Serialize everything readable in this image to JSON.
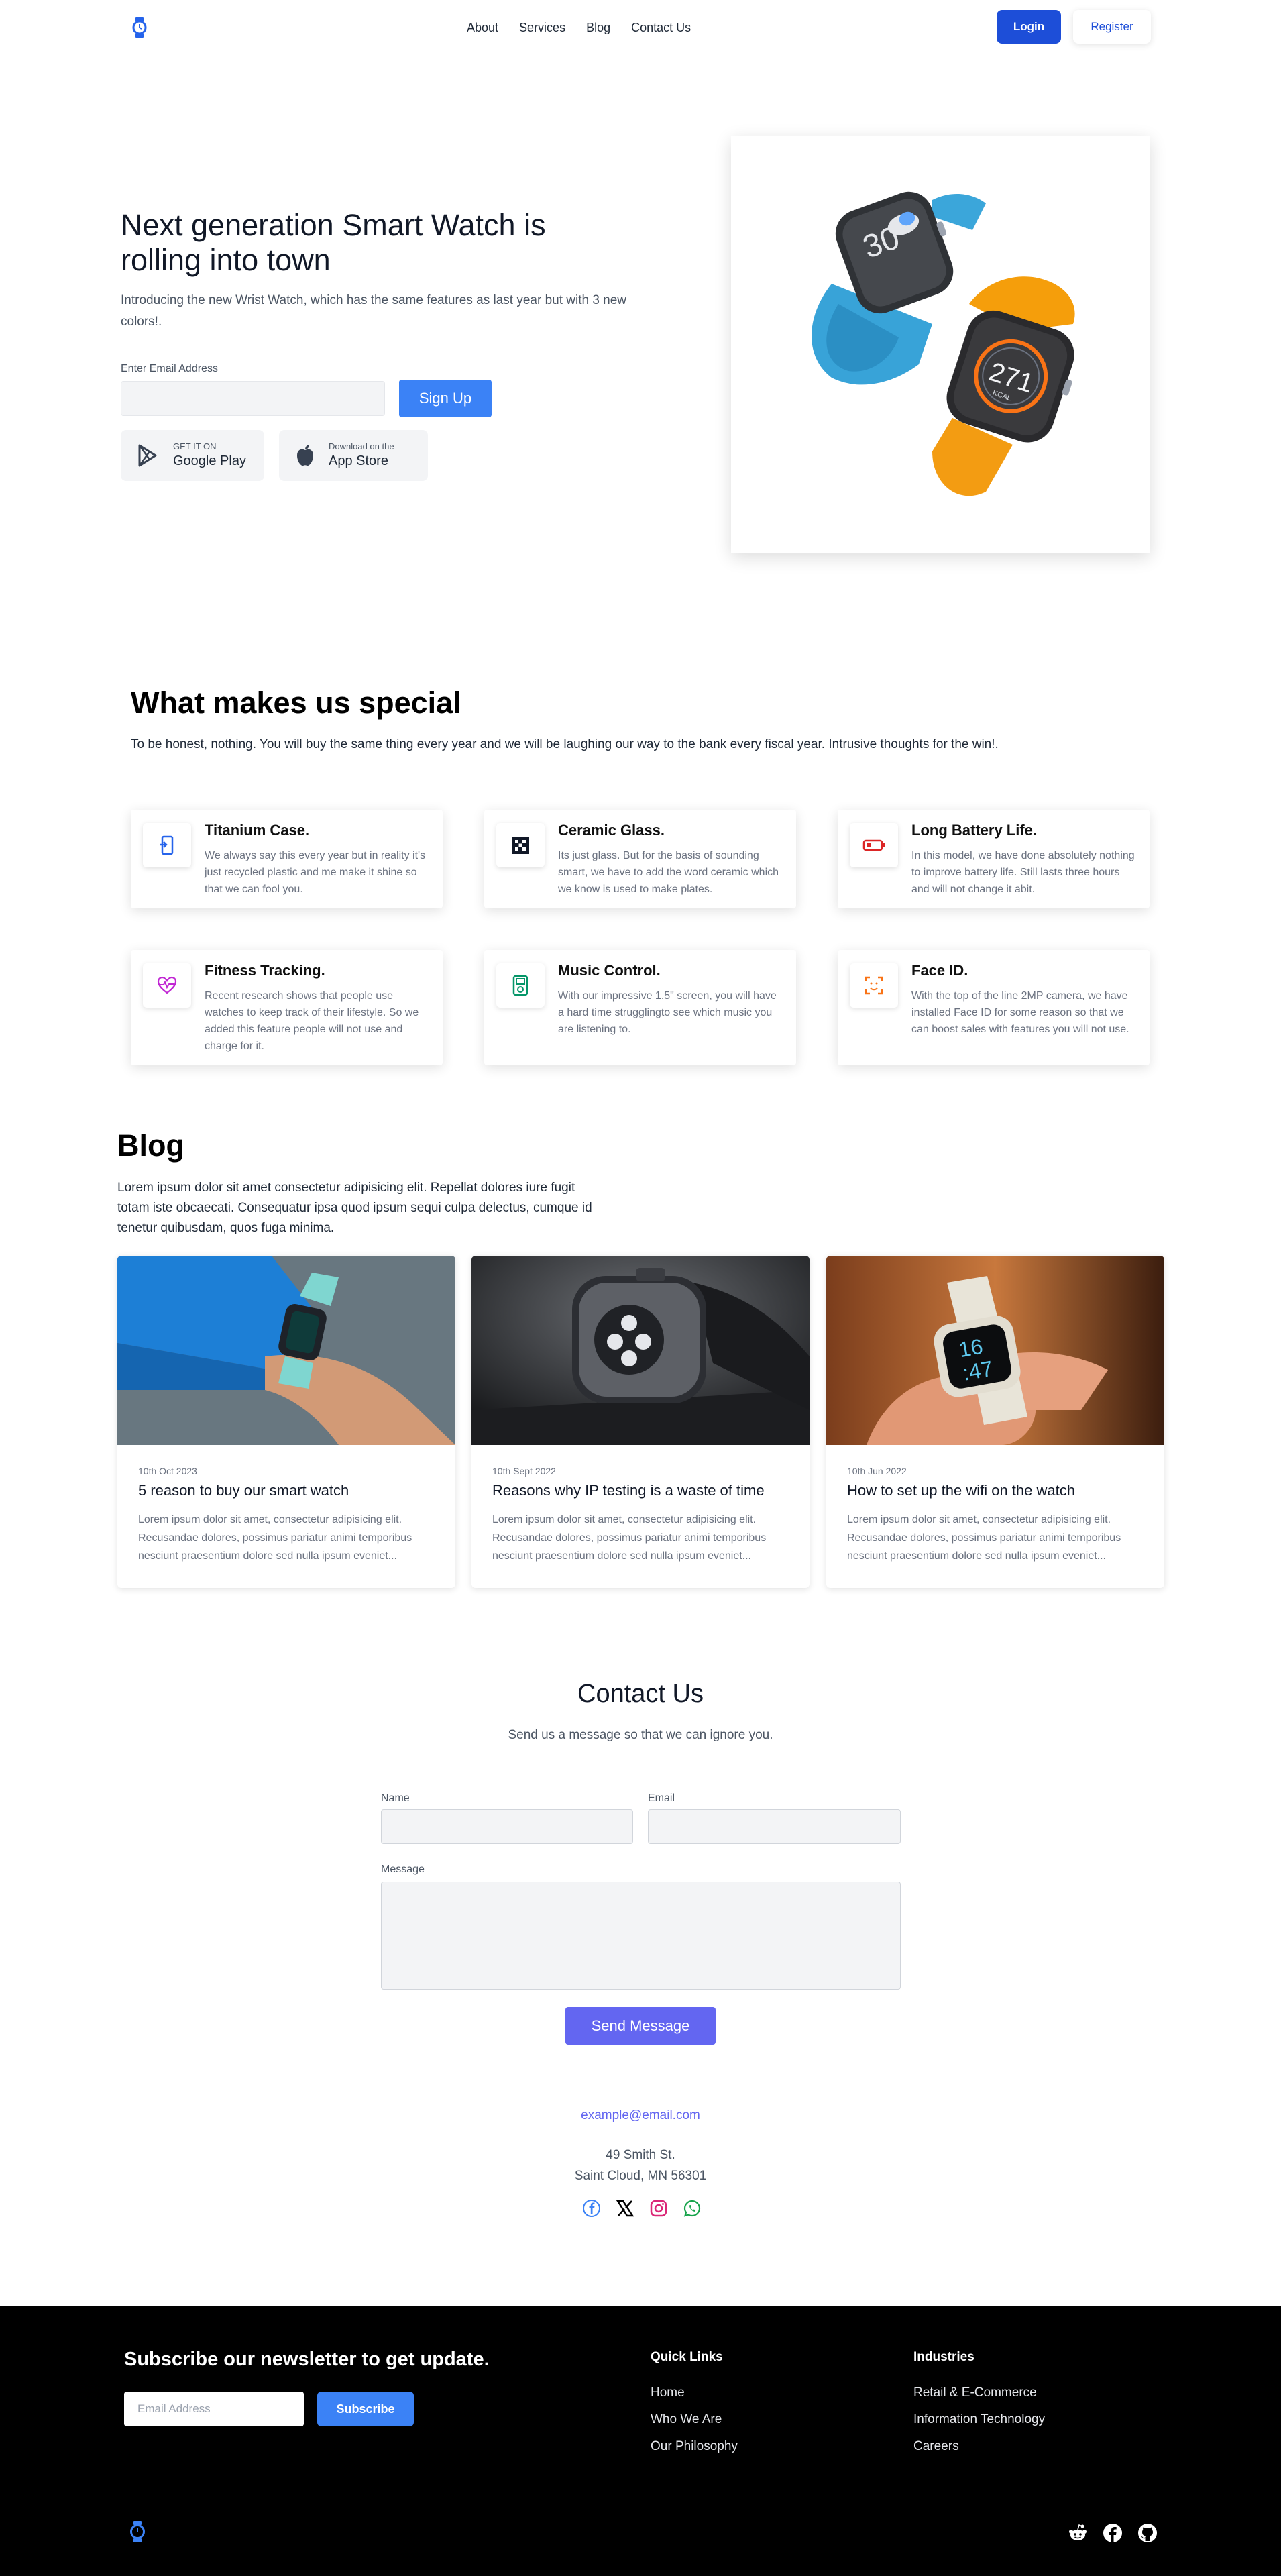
{
  "nav": {
    "logo_icon": "watch-icon",
    "links": [
      "About",
      "Services",
      "Blog",
      "Contact Us"
    ],
    "login_label": "Login",
    "register_label": "Register",
    "accent_color": "#1d4ed8"
  },
  "hero": {
    "title": "Next generation Smart Watch is rolling into town",
    "subtitle": "Introducing the new Wrist Watch, which has the same features as last year but with 3 new colors!.",
    "email_label": "Enter Email Address",
    "email_value": "",
    "signup_label": "Sign Up",
    "google_play": {
      "small": "GET IT ON",
      "big": "Google Play",
      "icon": "google-play-icon"
    },
    "app_store": {
      "small": "Download on the",
      "big": "App Store",
      "icon": "apple-icon"
    },
    "watch_blue": {
      "temp": "30"
    },
    "watch_orange": {
      "value": "271",
      "unit": "KCAL"
    }
  },
  "special": {
    "title": "What makes us special",
    "subtitle": "To be honest, nothing. You will buy the same thing every year and we will be laughing our way to the bank every fiscal year. Intrusive thoughts for the win!.",
    "features": [
      {
        "title": "Titanium Case.",
        "desc": "We always say this every year but in reality it's just recycled plastic and me make it shine so that we can fool you.",
        "icon": "phone-icon",
        "color": "#2563eb"
      },
      {
        "title": "Ceramic Glass.",
        "desc": "Its just glass. But for the basis of sounding smart, we have to add the word ceramic which we know is used to make plates.",
        "icon": "glass-icon",
        "color": "#111827"
      },
      {
        "title": "Long Battery Life.",
        "desc": "In this model, we have done absolutely nothing to improve battery life. Still lasts three hours and will not change it abit.",
        "icon": "battery-icon",
        "color": "#dc2626"
      },
      {
        "title": "Fitness Tracking.",
        "desc": "Recent research shows that people use watches to keep track of their lifestyle. So we added this feature people will not use and charge for it.",
        "icon": "heart-pulse-icon",
        "color": "#c026d3"
      },
      {
        "title": "Music Control.",
        "desc": "With our impressive 1.5\" screen, you will have a hard time strugglingto see which music you are listening to.",
        "icon": "music-player-icon",
        "color": "#059669"
      },
      {
        "title": "Face ID.",
        "desc": "With the top of the line 2MP camera, we have installed Face ID for some reason so that we can boost sales with features you will not use.",
        "icon": "face-id-icon",
        "color": "#f97316"
      }
    ]
  },
  "blog": {
    "title": "Blog",
    "subtitle": "Lorem ipsum dolor sit amet consectetur adipisicing elit. Repellat dolores iure fugit totam iste obcaecati. Consequatur ipsa quod ipsum sequi culpa delectus, cumque id tenetur quibusdam, quos fuga minima.",
    "posts": [
      {
        "date": "10th Oct 2023",
        "title": "5 reason to buy our smart watch",
        "desc": "Lorem ipsum dolor sit amet, consectetur adipisicing elit. Recusandae dolores, possimus pariatur animi temporibus nesciunt praesentium dolore sed nulla ipsum eveniet..."
      },
      {
        "date": "10th Sept 2022",
        "title": "Reasons why IP testing is a waste of time",
        "desc": "Lorem ipsum dolor sit amet, consectetur adipisicing elit. Recusandae dolores, possimus pariatur animi temporibus nesciunt praesentium dolore sed nulla ipsum eveniet..."
      },
      {
        "date": "10th Jun 2022",
        "title": "How to set up the wifi on the watch",
        "desc": "Lorem ipsum dolor sit amet, consectetur adipisicing elit. Recusandae dolores, possimus pariatur animi temporibus nesciunt praesentium dolore sed nulla ipsum eveniet...",
        "watch_time": "16\n:47"
      }
    ]
  },
  "contact": {
    "title": "Contact Us",
    "subtitle": "Send us a message so that we can ignore you.",
    "name_label": "Name",
    "email_label": "Email",
    "message_label": "Message",
    "name_value": "",
    "email_value": "",
    "message_value": "",
    "send_label": "Send Message",
    "email": "example@email.com",
    "address_line1": "49 Smith St.",
    "address_line2": "Saint Cloud, MN 56301",
    "social_icons": [
      "facebook-icon",
      "x-icon",
      "instagram-icon",
      "whatsapp-icon"
    ]
  },
  "footer": {
    "newsletter_title": "Subscribe our newsletter to get update.",
    "email_placeholder": "Email Address",
    "subscribe_label": "Subscribe",
    "quick_links_title": "Quick Links",
    "quick_links": [
      "Home",
      "Who We Are",
      "Our Philosophy"
    ],
    "industries_title": "Industries",
    "industries": [
      "Retail & E-Commerce",
      "Information Technology",
      "Careers"
    ],
    "social_icons": [
      "reddit-icon",
      "facebook-icon",
      "github-icon"
    ],
    "background": "#000000"
  }
}
